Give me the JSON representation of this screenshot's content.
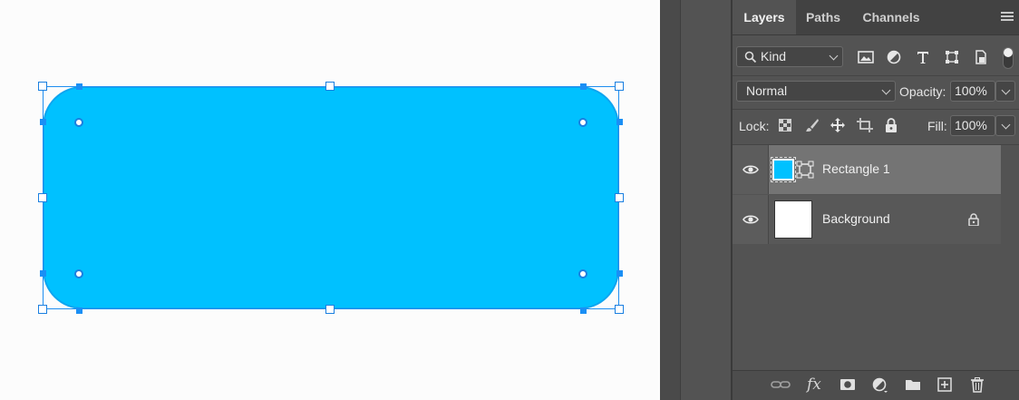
{
  "panel": {
    "tabs": [
      {
        "label": "Layers",
        "active": true
      },
      {
        "label": "Paths",
        "active": false
      },
      {
        "label": "Channels",
        "active": false
      }
    ],
    "filter": {
      "label": "Kind"
    },
    "blend_mode": "Normal",
    "opacity_label": "Opacity:",
    "opacity_value": "100%",
    "lock_label": "Lock:",
    "fill_label": "Fill:",
    "fill_value": "100%",
    "layers": [
      {
        "name": "Rectangle 1",
        "selected": true,
        "thumb_color": "#00c1ff",
        "locked": false
      },
      {
        "name": "Background",
        "selected": false,
        "thumb_color": "#ffffff",
        "locked": true
      }
    ],
    "bottom_icons": [
      "link-icon",
      "fx-icon",
      "mask-icon",
      "adjustment-icon",
      "folder-icon",
      "new-layer-icon",
      "trash-icon"
    ],
    "fx_label": "fx"
  },
  "canvas": {
    "shape_fill": "#00c1ff",
    "shape_stroke": "#0ea5f0",
    "selection_color": "#1a7fe0"
  }
}
